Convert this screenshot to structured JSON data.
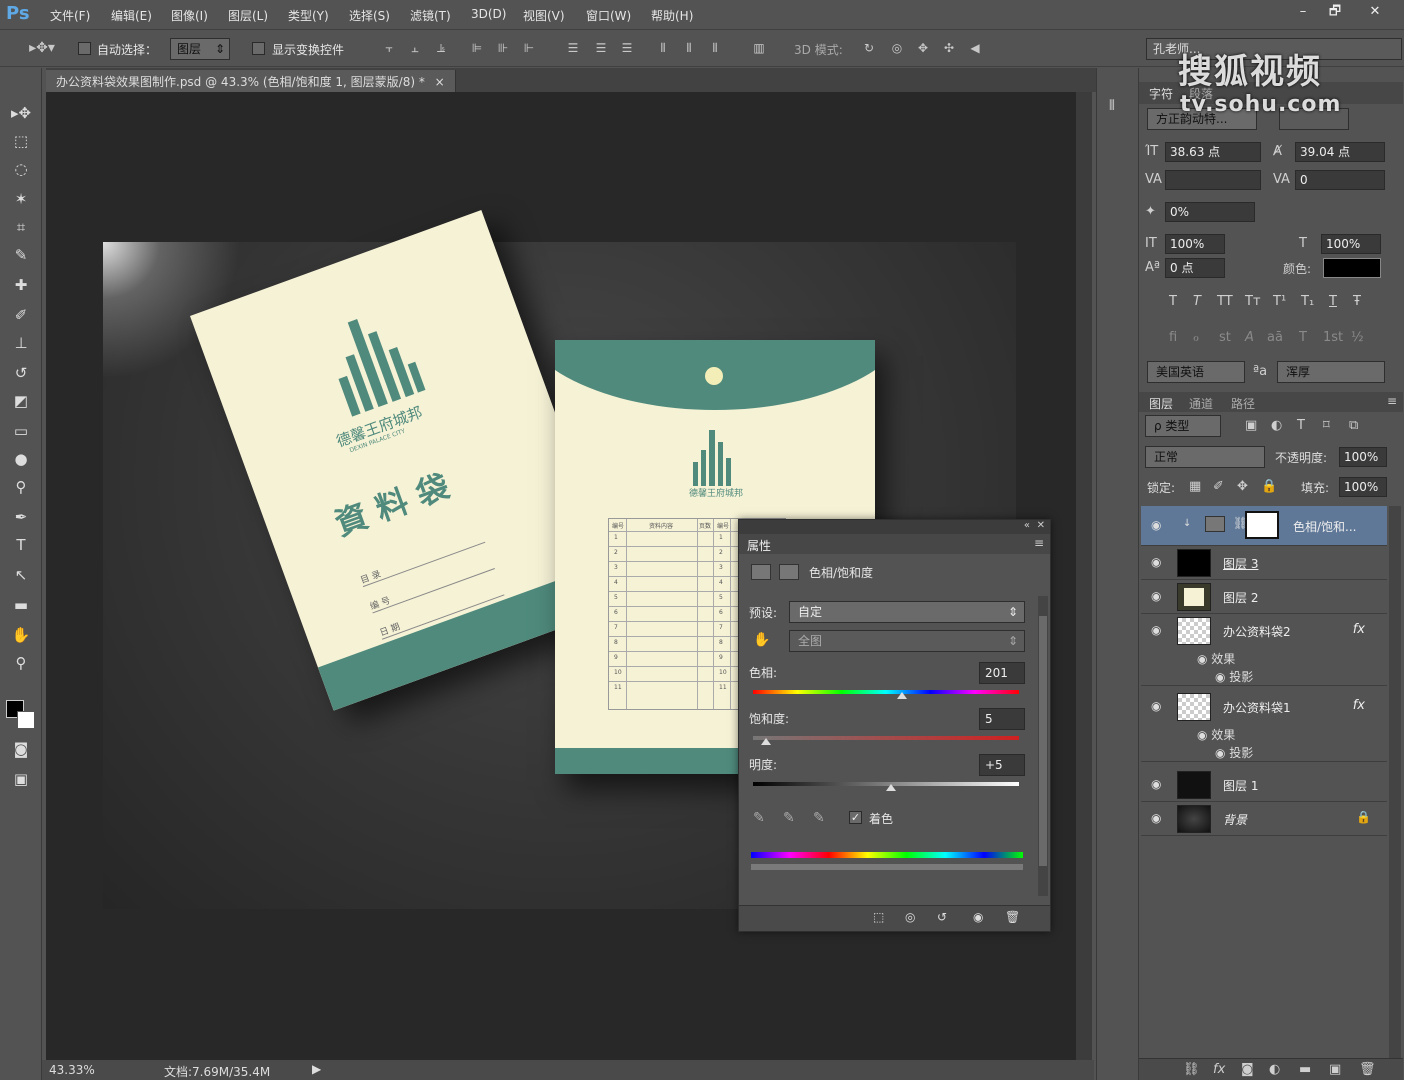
{
  "menubar": {
    "logo": "Ps",
    "items": [
      "文件(F)",
      "编辑(E)",
      "图像(I)",
      "图层(L)",
      "类型(Y)",
      "选择(S)",
      "滤镜(T)",
      "3D(D)",
      "视图(V)",
      "窗口(W)",
      "帮助(H)"
    ],
    "window_buttons": [
      "–",
      "🗗",
      "✕"
    ]
  },
  "options": {
    "auto_select_label": "自动选择：",
    "auto_select_value": "图层",
    "show_transform_label": "显示变换控件",
    "mode_3d_label": "3D 模式:",
    "workspace_value": "孔老师..."
  },
  "document": {
    "tab_title": "办公资料袋效果图制作.psd @ 43.3% (色相/饱和度 1, 图层蒙版/8) *",
    "close": "×"
  },
  "artwork": {
    "folder1_company": "德馨王府城邦",
    "folder1_company_en": "DEXIN PALACE CITY",
    "folder1_title": "資 料 袋",
    "folder1_fields": [
      "目 录",
      "编 号",
      "日 期"
    ],
    "folder2_company": "德馨王府城邦",
    "table_headers": [
      "编号",
      "资料内容",
      "页数",
      "编号"
    ],
    "table_rows": [
      "1",
      "2",
      "3",
      "4",
      "5",
      "6",
      "7",
      "8",
      "9",
      "10",
      "11"
    ]
  },
  "status": {
    "zoom": "43.33%",
    "doc": "文档:7.69M/35.4M"
  },
  "properties": {
    "title": "属性",
    "adjustment_name": "色相/饱和度",
    "preset_label": "预设:",
    "preset_value": "自定",
    "channel_value": "全图",
    "hue_label": "色相:",
    "hue_value": "201",
    "hue_fraction": 0.56,
    "saturation_label": "饱和度:",
    "saturation_value": "5",
    "saturation_fraction": 0.05,
    "lightness_label": "明度:",
    "lightness_value": "+5",
    "lightness_fraction": 0.52,
    "colorize_label": "着色",
    "colorize_checked": true
  },
  "character": {
    "tab_char": "字符",
    "tab_para": "段落",
    "font_family": "方正韵动特...",
    "font_size": "38.63 点",
    "leading": "39.04 点",
    "kerning": "",
    "tracking": "0",
    "tsume": "0%",
    "vscale": "100%",
    "hscale": "100%",
    "baseline": "0 点",
    "color_label": "颜色:",
    "color_value": "#000000",
    "style_buttons": [
      "T",
      "T",
      "TT",
      "Tт",
      "T¹",
      "T₁",
      "T",
      "Ŧ"
    ],
    "opentype_buttons": [
      "fi",
      "ℴ",
      "st",
      "A",
      "aā",
      "T",
      "1st",
      "½"
    ],
    "language": "美国英语",
    "aa_icon": "ªa",
    "antialias": "浑厚"
  },
  "layers_panel": {
    "tab_layers": "图层",
    "tab_channels": "通道",
    "tab_paths": "路径",
    "filter_label": "ρ 类型",
    "blend_mode": "正常",
    "opacity_label": "不透明度:",
    "opacity_value": "100%",
    "lock_label": "锁定:",
    "fill_label": "填充:",
    "fill_value": "100%",
    "layers": [
      {
        "name": "色相/饱和..."
      },
      {
        "name": "图层 3"
      },
      {
        "name": "图层 2"
      },
      {
        "name": "办公资料袋2",
        "fx": "fx",
        "effects_label": "效果",
        "effect": "投影"
      },
      {
        "name": "办公资料袋1",
        "fx": "fx",
        "effects_label": "效果",
        "effect": "投影"
      },
      {
        "name": "图层 1"
      },
      {
        "name": "背景"
      }
    ]
  },
  "watermark": {
    "brand": "搜狐视频",
    "url": "tv.sohu.com"
  },
  "colors": {
    "accent_teal": "#4f8a7c",
    "paper": "#f6f2d6",
    "selected_layer": "#5f7898"
  }
}
